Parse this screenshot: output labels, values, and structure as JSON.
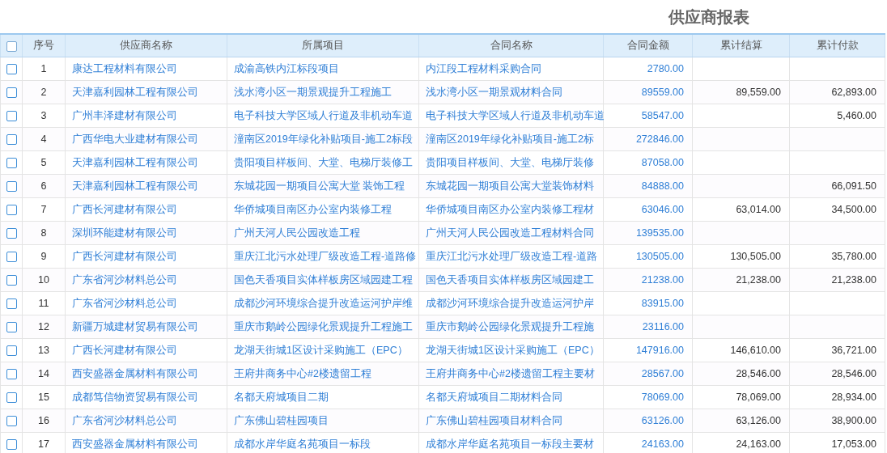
{
  "title": "供应商报表",
  "table": {
    "header_checkbox": {
      "checked": false
    },
    "columns": [
      "序号",
      "供应商名称",
      "所属项目",
      "合同名称",
      "合同金额",
      "累计结算",
      "累计付款"
    ],
    "rows": [
      {
        "checked": false,
        "no": "1",
        "supplier": "康达工程材料有限公司",
        "project": "成渝高铁内江标段项目",
        "contract": "内江段工程材料采购合同",
        "amount": "2780.00"
      },
      {
        "checked": false,
        "no": "2",
        "supplier": "天津嘉利园林工程有限公司",
        "project": "浅水湾小区一期景观提升工程施工",
        "contract": "浅水湾小区一期景观材料合同",
        "amount": "89559.00",
        "settled": "89,559.00",
        "paid": "62,893.00"
      },
      {
        "checked": false,
        "no": "3",
        "supplier": "广州丰泽建材有限公司",
        "project": "电子科技大学区域人行道及非机动车道",
        "contract": "电子科技大学区域人行道及非机动车道",
        "amount": "58547.00",
        "paid": "5,460.00"
      },
      {
        "checked": false,
        "no": "4",
        "supplier": "广西华电大业建材有限公司",
        "project": "潼南区2019年绿化补贴项目-施工2标段",
        "contract": "潼南区2019年绿化补贴项目-施工2标",
        "amount": "272846.00"
      },
      {
        "checked": false,
        "no": "5",
        "supplier": "天津嘉利园林工程有限公司",
        "project": "贵阳项目样板间、大堂、电梯厅装修工",
        "contract": "贵阳项目样板间、大堂、电梯厅装修",
        "amount": "87058.00"
      },
      {
        "checked": false,
        "no": "6",
        "supplier": "天津嘉利园林工程有限公司",
        "project": "东城花园一期项目公寓大堂 装饰工程",
        "contract": "东城花园一期项目公寓大堂装饰材料",
        "amount": "84888.00",
        "paid": "66,091.50"
      },
      {
        "checked": false,
        "no": "7",
        "supplier": "广西长河建材有限公司",
        "project": "华侨城项目南区办公室内装修工程",
        "contract": "华侨城项目南区办公室内装修工程材",
        "amount": "63046.00",
        "settled": "63,014.00",
        "paid": "34,500.00"
      },
      {
        "checked": false,
        "no": "8",
        "supplier": "深圳环能建材有限公司",
        "project": "广州天河人民公园改造工程",
        "contract": "广州天河人民公园改造工程材料合同",
        "amount": "139535.00"
      },
      {
        "checked": false,
        "no": "9",
        "supplier": "广西长河建材有限公司",
        "project": "重庆江北污水处理厂级改造工程-道路修",
        "contract": "重庆江北污水处理厂级改造工程-道路",
        "amount": "130505.00",
        "settled": "130,505.00",
        "paid": "35,780.00"
      },
      {
        "checked": false,
        "no": "10",
        "supplier": "广东省河沙材料总公司",
        "project": "国色天香项目实体样板房区域园建工程",
        "contract": "国色天香项目实体样板房区域园建工",
        "amount": "21238.00",
        "settled": "21,238.00",
        "paid": "21,238.00"
      },
      {
        "checked": false,
        "no": "11",
        "supplier": "广东省河沙材料总公司",
        "project": "成都沙河环境综合提升改造运河护岸维",
        "contract": "成都沙河环境综合提升改造运河护岸",
        "amount": "83915.00"
      },
      {
        "checked": false,
        "no": "12",
        "supplier": "新疆万城建材贸易有限公司",
        "project": "重庆市鹅岭公园绿化景观提升工程施工",
        "contract": "重庆市鹅岭公园绿化景观提升工程施",
        "amount": "23116.00"
      },
      {
        "checked": false,
        "no": "13",
        "supplier": "广西长河建材有限公司",
        "project": "龙湖天街城1区设计采购施工（EPC）",
        "contract": "龙湖天街城1区设计采购施工（EPC）",
        "amount": "147916.00",
        "settled": "146,610.00",
        "paid": "36,721.00"
      },
      {
        "checked": false,
        "no": "14",
        "supplier": "西安盛器金属材料有限公司",
        "project": "王府井商务中心#2楼遗留工程",
        "contract": "王府井商务中心#2楼遗留工程主要材",
        "amount": "28567.00",
        "settled": "28,546.00",
        "paid": "28,546.00"
      },
      {
        "checked": false,
        "no": "15",
        "supplier": "成都笃信物资贸易有限公司",
        "project": "名都天府城项目二期",
        "contract": "名都天府城项目二期材料合同",
        "amount": "78069.00",
        "settled": "78,069.00",
        "paid": "28,934.00"
      },
      {
        "checked": false,
        "no": "16",
        "supplier": "广东省河沙材料总公司",
        "project": "广东佛山碧桂园项目",
        "contract": "广东佛山碧桂园项目材料合同",
        "amount": "63126.00",
        "settled": "63,126.00",
        "paid": "38,900.00"
      },
      {
        "checked": false,
        "no": "17",
        "supplier": "西安盛器金属材料有限公司",
        "project": "成都水岸华庭名苑项目一标段",
        "contract": "成都水岸华庭名苑项目一标段主要材",
        "amount": "24163.00",
        "settled": "24,163.00",
        "paid": "17,053.00"
      }
    ]
  }
}
